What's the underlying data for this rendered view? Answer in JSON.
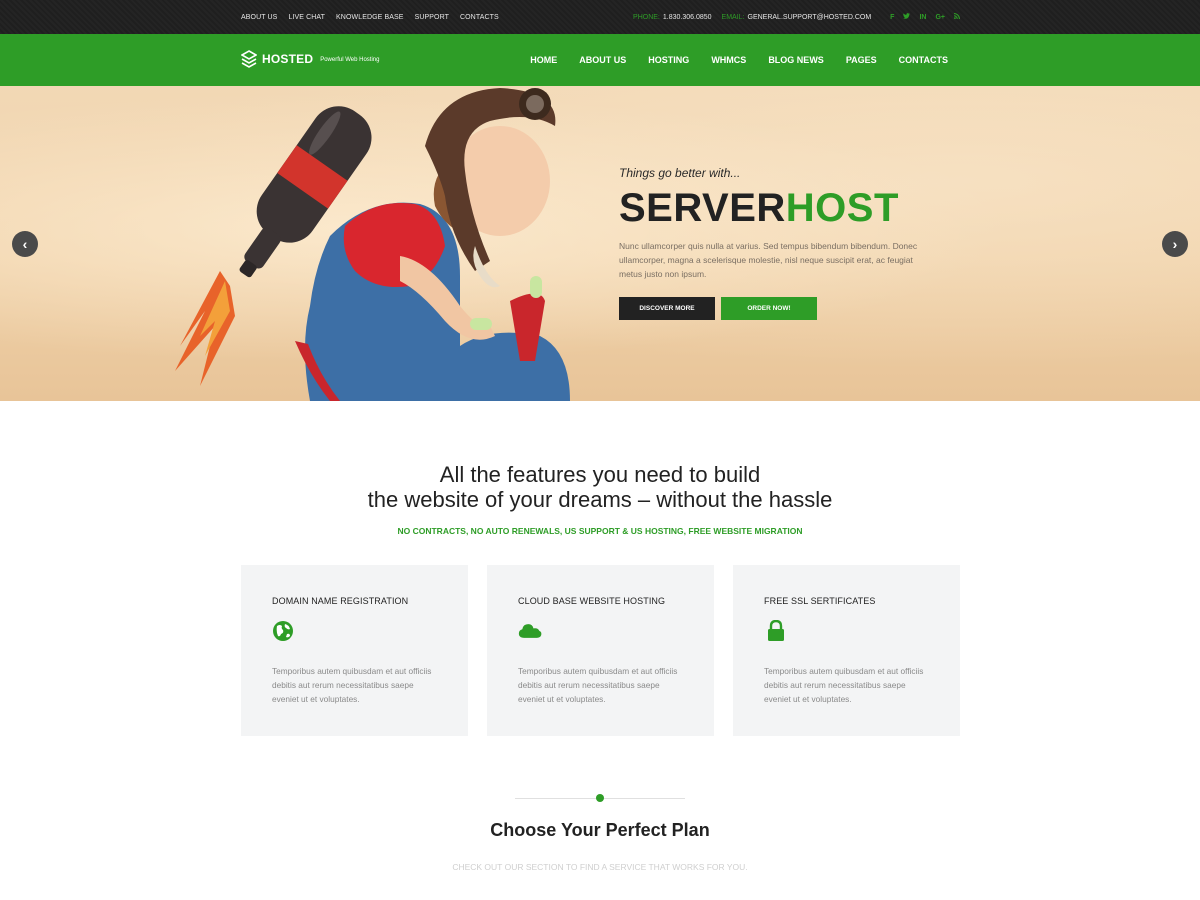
{
  "topbar": {
    "links": [
      "ABOUT US",
      "LIVE CHAT",
      "KNOWLEDGE BASE",
      "SUPPORT",
      "CONTACTS"
    ],
    "phone_label": "PHONE:",
    "phone": "1.830.306.0850",
    "email_label": "EMAIL:",
    "email": "GENERAL.SUPPORT@HOSTED.COM",
    "social": [
      "f",
      "t",
      "in",
      "G+",
      "rss"
    ]
  },
  "header": {
    "logo_name": "HOSTED",
    "logo_tagline": "Powerful Web Hosting",
    "nav": [
      "HOME",
      "ABOUT US",
      "HOSTING",
      "WHMCS",
      "BLOG NEWS",
      "PAGES",
      "CONTACTS"
    ]
  },
  "hero": {
    "pretitle": "Things go better with...",
    "title_dark": "SERVER",
    "title_green": "HOST",
    "text": "Nunc ullamcorper quis nulla at varius. Sed tempus bibendum bibendum. Donec ullamcorper, magna a scelerisque molestie, nisl neque suscipit erat, ac feugiat metus justo non ipsum.",
    "btn_discover": "DISCOVER MORE",
    "btn_order": "ORDER NOW!",
    "prev_icon": "‹",
    "next_icon": "›"
  },
  "features": {
    "title_line1": "All the features you need to build",
    "title_line2": "the website of your dreams – without the hassle",
    "subtitle": "NO CONTRACTS, NO AUTO RENEWALS, US SUPPORT & US HOSTING, FREE WEBSITE MIGRATION",
    "cards": [
      {
        "title": "DOMAIN NAME REGISTRATION",
        "icon": "globe-icon",
        "text": "Temporibus autem quibusdam et aut officiis debitis aut rerum necessitatibus saepe eveniet ut et voluptates."
      },
      {
        "title": "CLOUD BASE WEBSITE HOSTING",
        "icon": "cloud-icon",
        "text": "Temporibus autem quibusdam et aut officiis debitis aut rerum necessitatibus saepe eveniet ut et voluptates."
      },
      {
        "title": "FREE SSL SERTIFICATES",
        "icon": "lock-icon",
        "text": "Temporibus autem quibusdam et aut officiis debitis aut rerum necessitatibus saepe eveniet ut et voluptates."
      }
    ]
  },
  "plans": {
    "title": "Choose Your Perfect Plan",
    "subtitle": "CHECK OUT OUR SECTION TO FIND A SERVICE THAT WORKS FOR YOU."
  },
  "colors": {
    "brand_green": "#2e9d27",
    "dark": "#222222",
    "topbar": "#1f1f1f",
    "card_bg": "#f3f4f5"
  }
}
